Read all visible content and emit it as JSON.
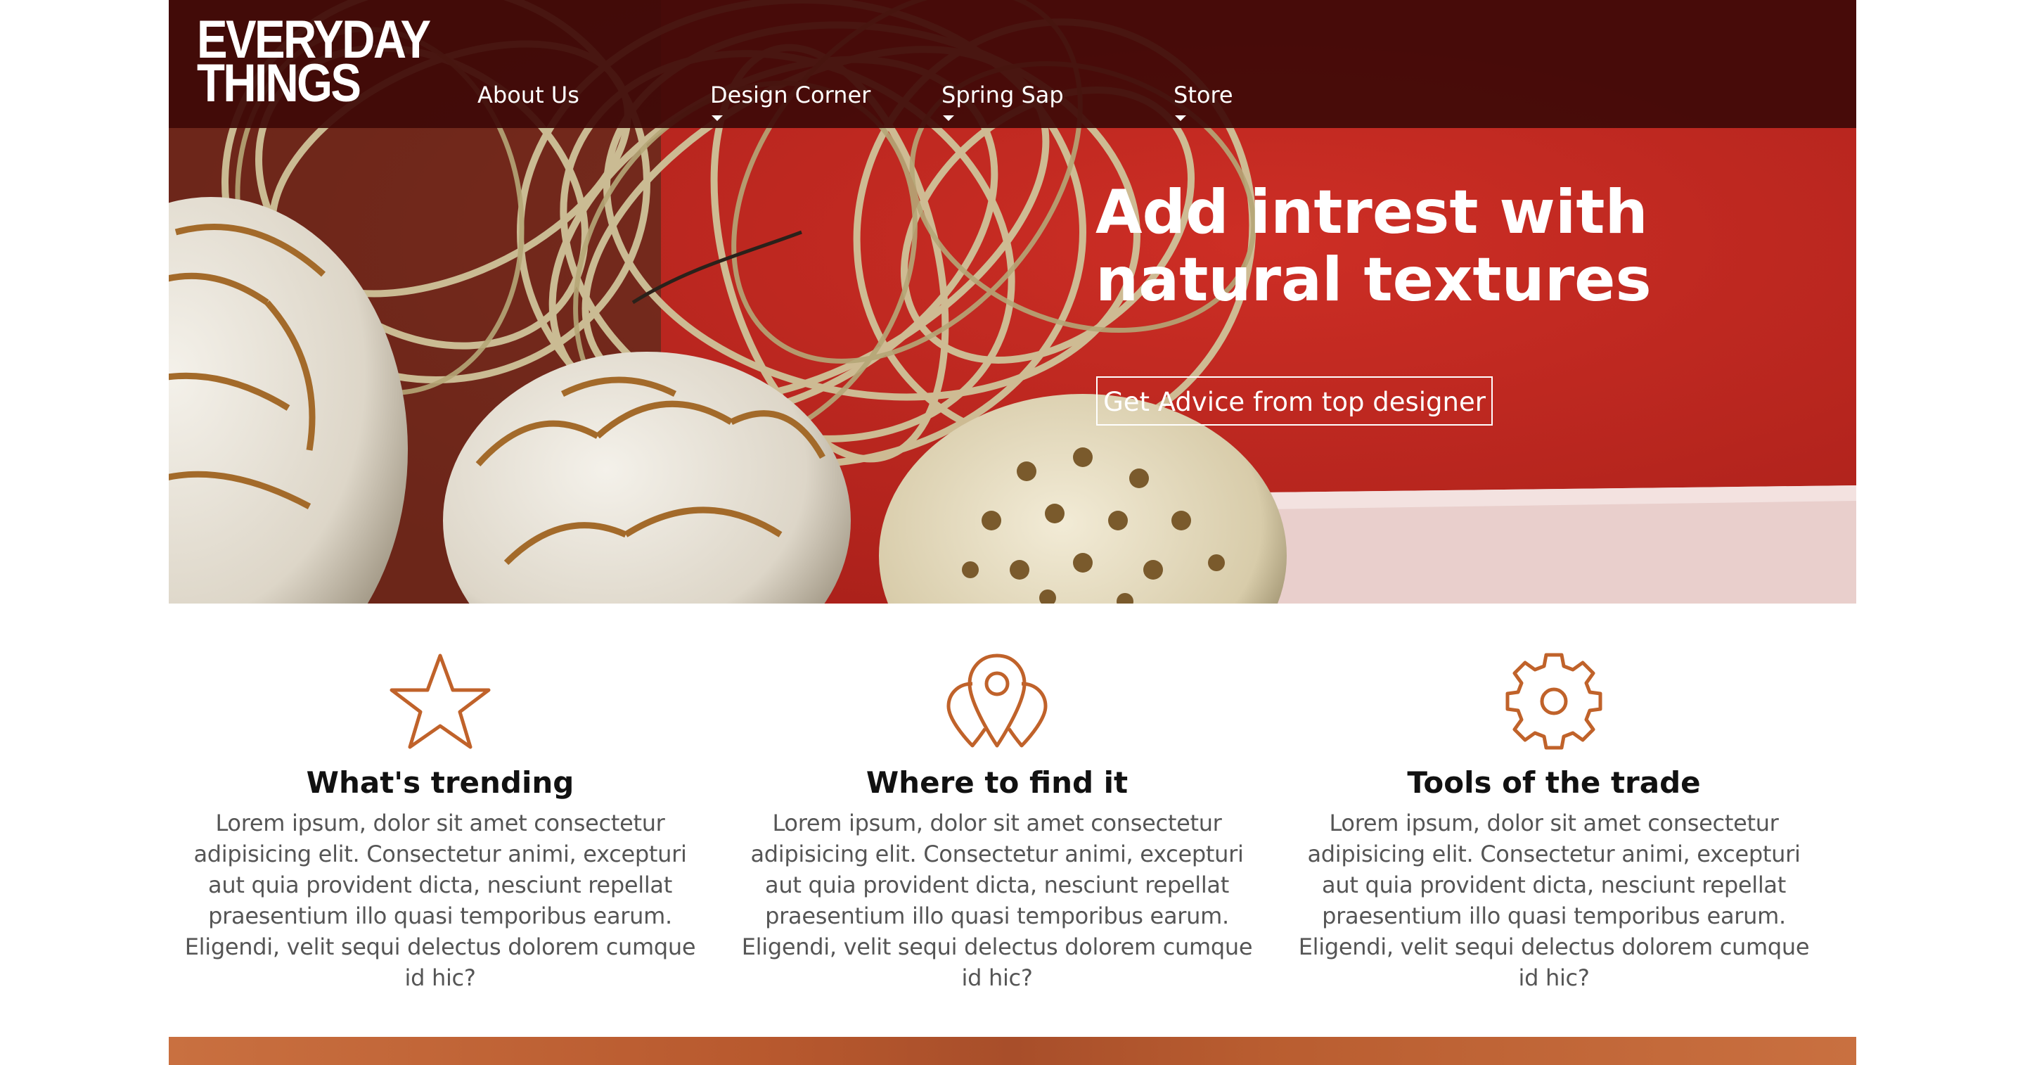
{
  "brand": {
    "logo_line1": "EVERYDAY",
    "logo_line2": "THINGS"
  },
  "nav": {
    "items": [
      {
        "label": "About Us",
        "has_dropdown": false
      },
      {
        "label": "Design Corner",
        "has_dropdown": true
      },
      {
        "label": "Spring Sap",
        "has_dropdown": true
      },
      {
        "label": "Store",
        "has_dropdown": true
      }
    ]
  },
  "hero": {
    "headline_line1": "Add intrest with",
    "headline_line2": "natural textures",
    "cta_label": "Get Advice from top designer"
  },
  "features": [
    {
      "icon": "star-icon",
      "title": "What's trending",
      "body": "Lorem ipsum, dolor sit amet consectetur adipisicing elit. Consectetur animi, excepturi aut quia provident dicta, nesciunt repellat praesentium illo quasi temporibus earum. Eligendi, velit sequi delectus dolorem cumque id hic?"
    },
    {
      "icon": "location-pins-icon",
      "title": "Where to find it",
      "body": "Lorem ipsum, dolor sit amet consectetur adipisicing elit. Consectetur animi, excepturi aut quia provident dicta, nesciunt repellat praesentium illo quasi temporibus earum. Eligendi, velit sequi delectus dolorem cumque id hic?"
    },
    {
      "icon": "gear-icon",
      "title": "Tools of the trade",
      "body": "Lorem ipsum, dolor sit amet consectetur adipisicing elit. Consectetur animi, excepturi aut quia provident dicta, nesciunt repellat praesentium illo quasi temporibus earum. Eligendi, velit sequi delectus dolorem cumque id hic?"
    }
  ],
  "colors": {
    "hero_red": "#c22a22",
    "topbar": "#3e0a08",
    "accent_orange": "#c0622a",
    "text_dark": "#111111",
    "text_body": "#555555"
  }
}
